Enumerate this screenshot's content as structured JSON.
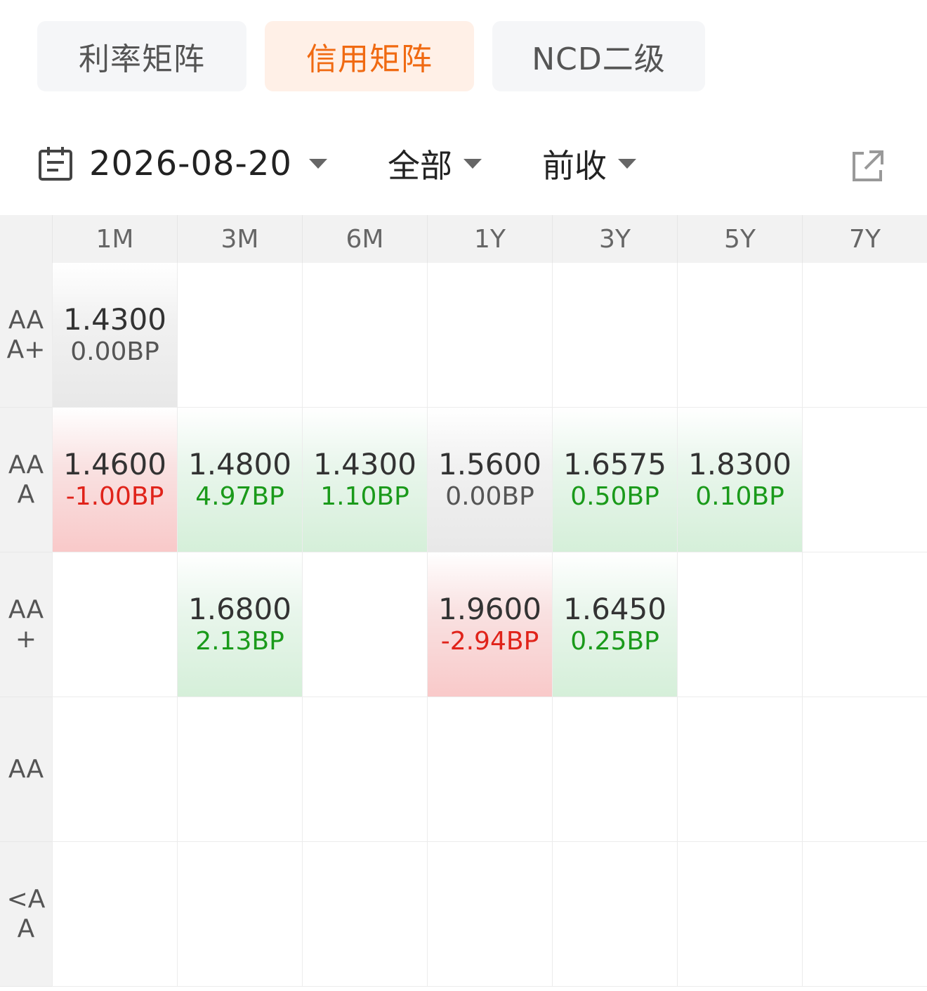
{
  "tabs": [
    {
      "label": "利率矩阵",
      "active": false
    },
    {
      "label": "信用矩阵",
      "active": true
    },
    {
      "label": "NCD二级",
      "active": false
    }
  ],
  "toolbar": {
    "date": "2026-08-20",
    "scope": "全部",
    "basis": "前收",
    "icons": {
      "calendar": "calendar-icon",
      "export": "external-link-icon",
      "dropdown": "caret-down-icon"
    }
  },
  "colors": {
    "accent": "#f06a12",
    "up": "#e0231a",
    "down": "#1a9a1a"
  },
  "matrix": {
    "columns": [
      "1M",
      "3M",
      "6M",
      "1Y",
      "3Y",
      "5Y",
      "7Y"
    ],
    "rows": [
      {
        "label": "AAA+",
        "cells": [
          {
            "yield": "1.4300",
            "change": "0.00BP",
            "trend": "flat"
          },
          null,
          null,
          null,
          null,
          null,
          null
        ]
      },
      {
        "label": "AAA",
        "cells": [
          {
            "yield": "1.4600",
            "change": "-1.00BP",
            "trend": "up"
          },
          {
            "yield": "1.4800",
            "change": "4.97BP",
            "trend": "down"
          },
          {
            "yield": "1.4300",
            "change": "1.10BP",
            "trend": "down"
          },
          {
            "yield": "1.5600",
            "change": "0.00BP",
            "trend": "flat"
          },
          {
            "yield": "1.6575",
            "change": "0.50BP",
            "trend": "down"
          },
          {
            "yield": "1.8300",
            "change": "0.10BP",
            "trend": "down"
          },
          null
        ]
      },
      {
        "label": "AA+",
        "cells": [
          null,
          {
            "yield": "1.6800",
            "change": "2.13BP",
            "trend": "down"
          },
          null,
          {
            "yield": "1.9600",
            "change": "-2.94BP",
            "trend": "up"
          },
          {
            "yield": "1.6450",
            "change": "0.25BP",
            "trend": "down"
          },
          null,
          null
        ]
      },
      {
        "label": "AA",
        "cells": [
          null,
          null,
          null,
          null,
          null,
          null,
          null
        ]
      },
      {
        "label": "<AA",
        "cells": [
          null,
          null,
          null,
          null,
          null,
          null,
          null
        ]
      }
    ]
  }
}
